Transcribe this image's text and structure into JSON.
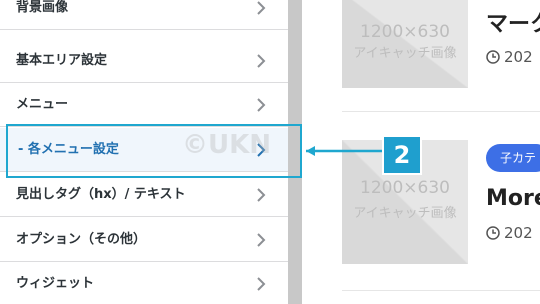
{
  "menu": {
    "items": [
      {
        "label": "背景画像"
      },
      {
        "label": "基本エリア設定"
      },
      {
        "label": "メニュー"
      },
      {
        "label": "- 各メニュー設定",
        "selected": true
      },
      {
        "label": "見出しタグ（hx）/ テキスト"
      },
      {
        "label": "オプション（その他）"
      },
      {
        "label": "ウィジェット"
      }
    ]
  },
  "watermark": "©UKN",
  "preview": {
    "thumbnail": {
      "size_text": "1200×630",
      "caption": "アイキャッチ画像"
    },
    "posts": [
      {
        "title": "マーク",
        "date": "202"
      },
      {
        "category": "子カテ",
        "title": "More",
        "date": "202"
      }
    ]
  },
  "callout": {
    "number": "2"
  },
  "colors": {
    "accent": "#1fa7cf",
    "badge": "#3d6fe6",
    "selected_text": "#2271b1"
  }
}
